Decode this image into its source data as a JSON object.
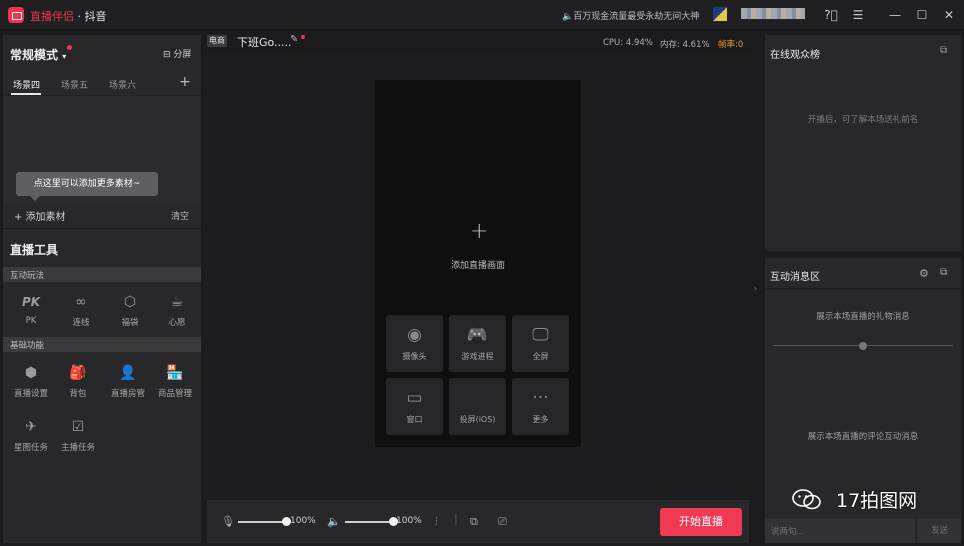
{
  "titlebar": {
    "brand": "直播伴侣",
    "app_suffix": "· 抖音",
    "notice": "百万现金流量最受永劫无间大神",
    "icons": [
      "help-icon",
      "menu-icon",
      "minimize-icon",
      "maximize-icon",
      "close-icon"
    ]
  },
  "left": {
    "mode": "常规模式",
    "split": "分屏",
    "scene_tabs": [
      "场景四",
      "场景五",
      "场景六"
    ],
    "tooltip": "点这里可以添加更多素材~",
    "add_material": "+ 添加素材",
    "clear": "清空",
    "tools_title": "直播工具",
    "interactive_label": "互动玩法",
    "interactive_tools": [
      {
        "label": "PK",
        "icon": "pk-icon"
      },
      {
        "label": "连线",
        "icon": "link-icon"
      },
      {
        "label": "福袋",
        "icon": "lucky-bag-icon"
      },
      {
        "label": "心愿",
        "icon": "wish-icon"
      }
    ],
    "basic_label": "基础功能",
    "basic_tools": [
      {
        "label": "直播设置",
        "icon": "settings-hex-icon"
      },
      {
        "label": "背包",
        "icon": "backpack-icon"
      },
      {
        "label": "直播房管",
        "icon": "room-admin-icon"
      },
      {
        "label": "商品管理",
        "icon": "store-icon"
      },
      {
        "label": "星图任务",
        "icon": "star-map-icon"
      },
      {
        "label": "主播任务",
        "icon": "task-check-icon"
      }
    ]
  },
  "center": {
    "tag": "电商",
    "room_title": "下班Go.....",
    "cpu": "CPU: 4.94%",
    "mem": "内存: 4.61%",
    "fps": "帧率:0",
    "canvas_hint": "添加直播画面",
    "sources": [
      {
        "label": "摄像头",
        "icon": "camera-icon"
      },
      {
        "label": "游戏进程",
        "icon": "gamepad-icon"
      },
      {
        "label": "全屏",
        "icon": "monitor-icon"
      },
      {
        "label": "窗口",
        "icon": "window-icon"
      },
      {
        "label": "投屏(iOS)",
        "icon": "apple-icon"
      },
      {
        "label": "更多",
        "icon": "more-icon"
      }
    ]
  },
  "bottom": {
    "mic_volume": "100%",
    "speaker_volume": "100%",
    "mic_level": 1.0,
    "speaker_level": 1.0,
    "start_live": "开始直播"
  },
  "right": {
    "audience_title": "在线观众榜",
    "audience_hint": "开播后，可了解本场送礼前名",
    "messages_title": "互动消息区",
    "gift_hint": "展示本场直播的礼物消息",
    "comment_hint": "展示本场直播的评论互动消息",
    "input_placeholder": "说两句...",
    "send": "发送"
  },
  "watermark": "17拍图网",
  "colors": {
    "accent": "#f0354f",
    "fps_warning": "#f2992d",
    "panel_bg": "#28282b",
    "stage_bg": "#1d1d1f"
  }
}
